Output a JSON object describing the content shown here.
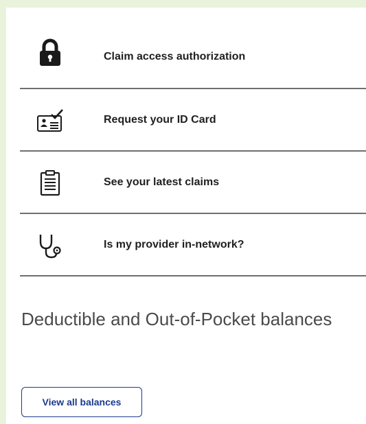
{
  "menu": {
    "items": [
      {
        "label": "Claim access authorization",
        "icon": "lock-icon"
      },
      {
        "label": "Request your ID Card",
        "icon": "id-card-icon"
      },
      {
        "label": "See your latest claims",
        "icon": "clipboard-icon"
      },
      {
        "label": "Is my provider in-network?",
        "icon": "stethoscope-icon"
      }
    ]
  },
  "balances": {
    "title": "Deductible and Out-of-Pocket balances",
    "button_label": "View all balances"
  }
}
